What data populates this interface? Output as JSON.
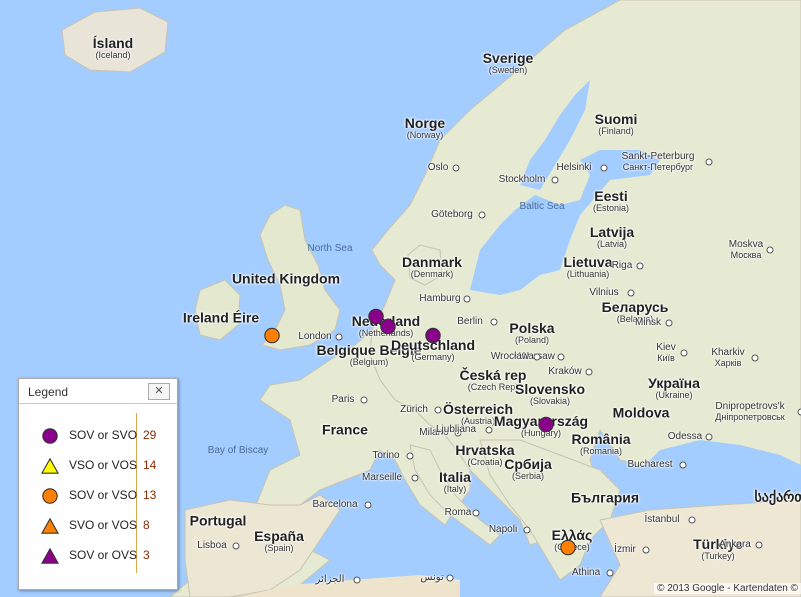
{
  "map": {
    "labels": [
      {
        "id": "iceland",
        "cls": "country",
        "main": "Ísland",
        "sub": "(Iceland)"
      },
      {
        "id": "sweden",
        "cls": "country",
        "main": "Sverige",
        "sub": "(Sweden)"
      },
      {
        "id": "norway",
        "cls": "country",
        "main": "Norge",
        "sub": "(Norway)"
      },
      {
        "id": "finland",
        "cls": "country",
        "main": "Suomi",
        "sub": "(Finland)"
      },
      {
        "id": "estonia",
        "cls": "country",
        "main": "Eesti",
        "sub": "(Estonia)"
      },
      {
        "id": "latvia",
        "cls": "country",
        "main": "Latvija",
        "sub": "(Latvia)"
      },
      {
        "id": "lithuania",
        "cls": "country",
        "main": "Lietuva",
        "sub": "(Lithuania)"
      },
      {
        "id": "belarus",
        "cls": "country",
        "main": "Беларусь",
        "sub": "(Belarus)"
      },
      {
        "id": "uk",
        "cls": "country",
        "main": "United Kingdom",
        "sub": ""
      },
      {
        "id": "ireland",
        "cls": "country",
        "main": "Ireland Éire",
        "sub": ""
      },
      {
        "id": "denmark",
        "cls": "country",
        "main": "Danmark",
        "sub": "(Denmark)"
      },
      {
        "id": "netherlands",
        "cls": "country",
        "main": "Nederland",
        "sub": "(Netherlands)"
      },
      {
        "id": "belgium",
        "cls": "country",
        "main": "Belgique België",
        "sub": "(Belgium)"
      },
      {
        "id": "germany",
        "cls": "country",
        "main": "Deutschland",
        "sub": "(Germany)"
      },
      {
        "id": "poland",
        "cls": "country",
        "main": "Polska",
        "sub": "(Poland)"
      },
      {
        "id": "czech",
        "cls": "country",
        "main": "Česká rep",
        "sub": "(Czech Rep)"
      },
      {
        "id": "slovakia",
        "cls": "country",
        "main": "Slovensko",
        "sub": "(Slovakia)"
      },
      {
        "id": "austria",
        "cls": "country",
        "main": "Österreich",
        "sub": "(Austria)"
      },
      {
        "id": "hungary",
        "cls": "country",
        "main": "Magyarország",
        "sub": "(Hungary)"
      },
      {
        "id": "ukraine",
        "cls": "country",
        "main": "Україна",
        "sub": "(Ukraine)"
      },
      {
        "id": "moldova",
        "cls": "country",
        "main": "Moldova",
        "sub": ""
      },
      {
        "id": "romania",
        "cls": "country",
        "main": "România",
        "sub": "(Romania)"
      },
      {
        "id": "croatia",
        "cls": "country",
        "main": "Hrvatska",
        "sub": "(Croatia)"
      },
      {
        "id": "serbia",
        "cls": "country",
        "main": "Србија",
        "sub": "(Serbia)"
      },
      {
        "id": "bulgaria",
        "cls": "country",
        "main": "България",
        "sub": ""
      },
      {
        "id": "france",
        "cls": "country",
        "main": "France",
        "sub": ""
      },
      {
        "id": "italy",
        "cls": "country",
        "main": "Italia",
        "sub": "(Italy)"
      },
      {
        "id": "portugal",
        "cls": "country",
        "main": "Portugal",
        "sub": ""
      },
      {
        "id": "spain",
        "cls": "country",
        "main": "España",
        "sub": "(Spain)"
      },
      {
        "id": "greece",
        "cls": "country",
        "main": "Ελλάς",
        "sub": "(Greece)"
      },
      {
        "id": "turkey",
        "cls": "country",
        "main": "Türkiye",
        "sub": "(Turkey)"
      },
      {
        "id": "georgia",
        "cls": "country",
        "main": "საქართ",
        "sub": ""
      },
      {
        "id": "northsea",
        "cls": "sea",
        "main": "North Sea",
        "sub": ""
      },
      {
        "id": "baltic",
        "cls": "sea",
        "main": "Baltic Sea",
        "sub": ""
      },
      {
        "id": "biscay",
        "cls": "sea",
        "main": "Bay of Biscay",
        "sub": ""
      },
      {
        "id": "oslo",
        "cls": "city",
        "main": "Oslo",
        "sub": ""
      },
      {
        "id": "stockholm",
        "cls": "city",
        "main": "Stockholm",
        "sub": ""
      },
      {
        "id": "helsinki",
        "cls": "city",
        "main": "Helsinki",
        "sub": ""
      },
      {
        "id": "spb",
        "cls": "city",
        "main": "Sankt-Peterburg",
        "sub": "Санкт-Петербург"
      },
      {
        "id": "goteborg",
        "cls": "city",
        "main": "Göteborg",
        "sub": ""
      },
      {
        "id": "riga",
        "cls": "city",
        "main": "Riga",
        "sub": ""
      },
      {
        "id": "moskva",
        "cls": "city",
        "main": "Moskva",
        "sub": "Москва"
      },
      {
        "id": "vilnius",
        "cls": "city",
        "main": "Vilnius",
        "sub": ""
      },
      {
        "id": "minsk",
        "cls": "city",
        "main": "Minsk",
        "sub": ""
      },
      {
        "id": "hamburg",
        "cls": "city",
        "main": "Hamburg",
        "sub": ""
      },
      {
        "id": "berlin",
        "cls": "city",
        "main": "Berlin",
        "sub": ""
      },
      {
        "id": "warsaw",
        "cls": "city",
        "main": "Warsaw",
        "sub": ""
      },
      {
        "id": "london",
        "cls": "city",
        "main": "London",
        "sub": ""
      },
      {
        "id": "paris",
        "cls": "city",
        "main": "Paris",
        "sub": ""
      },
      {
        "id": "wroclaw",
        "cls": "city",
        "main": "Wrocław",
        "sub": ""
      },
      {
        "id": "krakow",
        "cls": "city",
        "main": "Kraków",
        "sub": ""
      },
      {
        "id": "kiev",
        "cls": "city",
        "main": "Kiev",
        "sub": "Київ"
      },
      {
        "id": "kharkiv",
        "cls": "city",
        "main": "Kharkiv",
        "sub": "Харків"
      },
      {
        "id": "dnipro",
        "cls": "city",
        "main": "Dnipropetrovs'k",
        "sub": "Дніпропетровськ"
      },
      {
        "id": "zurich",
        "cls": "city",
        "main": "Zürich",
        "sub": ""
      },
      {
        "id": "milano",
        "cls": "city",
        "main": "Milano",
        "sub": ""
      },
      {
        "id": "torino",
        "cls": "city",
        "main": "Torino",
        "sub": ""
      },
      {
        "id": "ljubljana",
        "cls": "city",
        "main": "Ljubljana",
        "sub": ""
      },
      {
        "id": "marseille",
        "cls": "city",
        "main": "Marseille",
        "sub": ""
      },
      {
        "id": "barcelona",
        "cls": "city",
        "main": "Barcelona",
        "sub": ""
      },
      {
        "id": "roma",
        "cls": "city",
        "main": "Roma",
        "sub": ""
      },
      {
        "id": "lisboa",
        "cls": "city",
        "main": "Lisboa",
        "sub": ""
      },
      {
        "id": "napoli",
        "cls": "city",
        "main": "Napoli",
        "sub": ""
      },
      {
        "id": "bucharest",
        "cls": "city",
        "main": "Bucharest",
        "sub": ""
      },
      {
        "id": "odessa",
        "cls": "city",
        "main": "Odessa",
        "sub": ""
      },
      {
        "id": "istanbul",
        "cls": "city",
        "main": "İstanbul",
        "sub": ""
      },
      {
        "id": "ankara",
        "cls": "city",
        "main": "Ankara",
        "sub": ""
      },
      {
        "id": "izmir",
        "cls": "city",
        "main": "İzmir",
        "sub": ""
      },
      {
        "id": "athina",
        "cls": "city",
        "main": "Athina",
        "sub": ""
      },
      {
        "id": "algiers",
        "cls": "city",
        "main": "الجزائر",
        "sub": ""
      },
      {
        "id": "tunis",
        "cls": "city",
        "main": "تونس",
        "sub": ""
      }
    ],
    "markers": [
      {
        "id": "m1",
        "shape": "circle",
        "color": "#8b008b",
        "legend": "SOV or SVO"
      },
      {
        "id": "m2",
        "shape": "circle",
        "color": "#8b008b",
        "legend": "SOV or SVO"
      },
      {
        "id": "m3",
        "shape": "circle",
        "color": "#8b008b",
        "legend": "SOV or SVO"
      },
      {
        "id": "m4",
        "shape": "circle",
        "color": "#8b008b",
        "legend": "SOV or SVO"
      },
      {
        "id": "m5",
        "shape": "circle",
        "color": "#ff7f00",
        "legend": "SOV or VSO"
      },
      {
        "id": "m6",
        "shape": "circle",
        "color": "#ff7f00",
        "legend": "SOV or VSO"
      }
    ]
  },
  "legend": {
    "title": "Legend",
    "close_label": "✕",
    "items": [
      {
        "shape": "circle",
        "color": "#8b008b",
        "label": "SOV or SVO",
        "count": "29"
      },
      {
        "shape": "triangle",
        "color": "#ffff00",
        "label": "VSO or VOS",
        "count": "14"
      },
      {
        "shape": "circle",
        "color": "#ff7f00",
        "label": "SOV or VSO",
        "count": "13"
      },
      {
        "shape": "triangle",
        "color": "#ff7f00",
        "label": "SVO or VOS",
        "count": "8"
      },
      {
        "shape": "triangle",
        "color": "#8b008b",
        "label": "SOV or OVS",
        "count": "3"
      }
    ]
  },
  "copyright": "© 2013 Google - Kartendaten ©"
}
